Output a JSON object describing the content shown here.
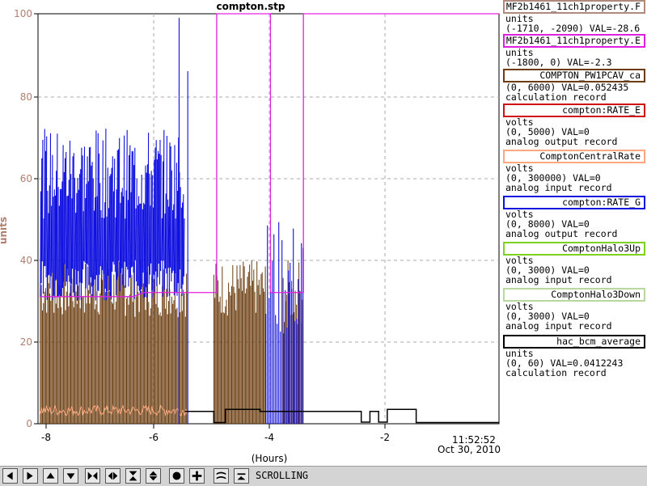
{
  "plot": {
    "title": "compton.stp",
    "ylabel": "units",
    "xlabel": "(Hours)",
    "time_label": "11:52:52",
    "date_label": "Oct 30, 2010",
    "y_ticks": [
      "0",
      "20",
      "40",
      "60",
      "80",
      "100"
    ],
    "x_ticks": [
      "-8",
      "-6",
      "-4",
      "-2"
    ],
    "ylabel_color": "#b07f6f"
  },
  "legend": [
    {
      "name": "MF2b1461_11ch1property.F",
      "color": "#b08a7a",
      "units": "units",
      "range": "(-1710, -2090) VAL=-28.6",
      "type": ""
    },
    {
      "name": "MF2b1461_11ch1property.E",
      "color": "#e020e0",
      "units": "units",
      "range": "(-1800, 0) VAL=-2.3",
      "type": ""
    },
    {
      "name": "COMPTON_PW1PCAV_ca",
      "color": "#6b3e10",
      "units": "",
      "range": "(0, 6000) VAL=0.052435",
      "type": "calculation record"
    },
    {
      "name": "compton:RATE_E",
      "color": "#d01010",
      "units": "volts",
      "range": "(0, 5000) VAL=0",
      "type": "analog output record"
    },
    {
      "name": "ComptonCentralRate",
      "color": "#ffa880",
      "units": "volts",
      "range": "(0, 300000) VAL=0",
      "type": "analog input record"
    },
    {
      "name": "compton:RATE_G",
      "color": "#1010e0",
      "units": "volts",
      "range": "(0, 8000) VAL=0",
      "type": "analog output record"
    },
    {
      "name": "ComptonHalo3Up",
      "color": "#80d020",
      "units": "volts",
      "range": "(0, 3000) VAL=0",
      "type": "analog input record"
    },
    {
      "name": "ComptonHalo3Down",
      "color": "#b8d8a0",
      "units": "volts",
      "range": "(0, 3000) VAL=0",
      "type": "analog input record"
    },
    {
      "name": "hac_bcm_average",
      "color": "#000000",
      "units": "units",
      "range": "(0, 60) VAL=0.0412243",
      "type": "calculation record"
    }
  ],
  "toolbar": {
    "status": "SCROLLING",
    "buttons": [
      "arrow-left-icon",
      "arrow-right-icon",
      "arrow-up-icon",
      "arrow-down-icon",
      "zoom-in-horizontal-icon",
      "zoom-out-horizontal-icon",
      "zoom-in-vertical-icon",
      "zoom-out-vertical-icon",
      "reset-icon",
      "add-icon",
      "scroll-mode-icon",
      "cursor-icon"
    ]
  }
}
